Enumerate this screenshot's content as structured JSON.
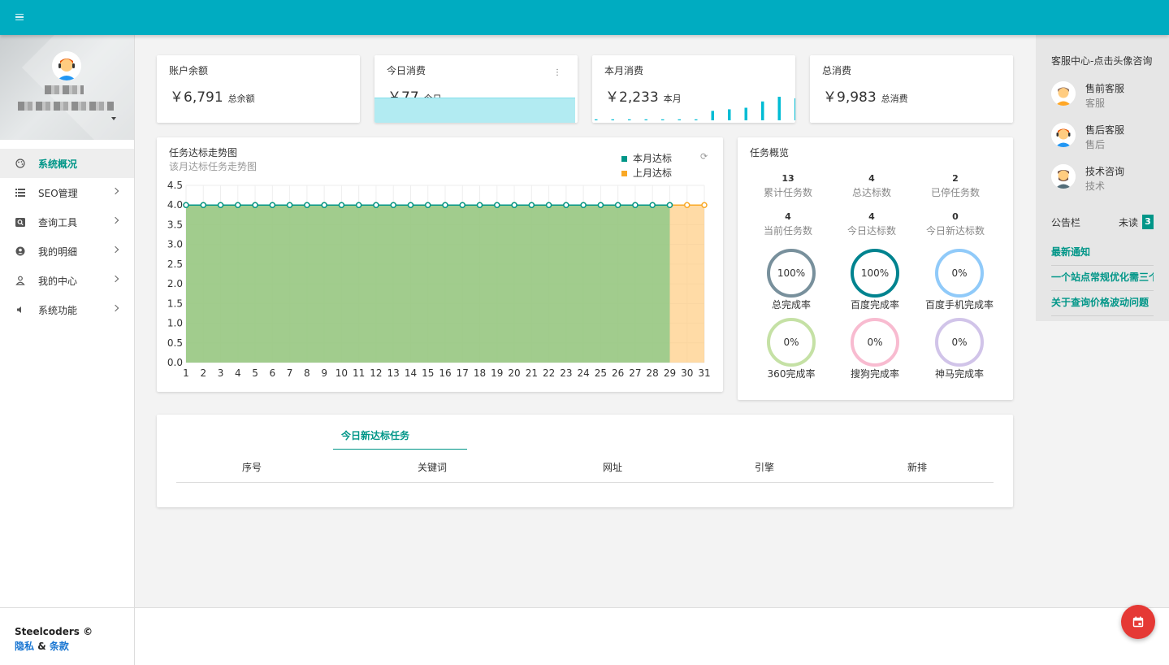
{
  "colors": {
    "topbar": "#00acc1",
    "accent": "#009688",
    "this_month": "#009688",
    "last_month": "#f9a825",
    "fab": "#e53935"
  },
  "topbar": {
    "menu_icon": "hamburger-icon"
  },
  "sidebar": {
    "items": [
      {
        "label": "系统概况",
        "icon": "palette-icon",
        "active": true
      },
      {
        "label": "SEO管理",
        "icon": "list-icon"
      },
      {
        "label": "查询工具",
        "icon": "search-box-icon"
      },
      {
        "label": "我的明细",
        "icon": "account-circle-icon"
      },
      {
        "label": "我的中心",
        "icon": "person-icon"
      },
      {
        "label": "系统功能",
        "icon": "volume-icon"
      }
    ],
    "footer": {
      "brand": "Steelcoders ©",
      "privacy": "隐私",
      "amp": "&",
      "terms": "条款"
    }
  },
  "stats": [
    {
      "title": "账户余额",
      "value": "￥6,791",
      "unit": "总余额"
    },
    {
      "title": "今日消费",
      "value": "￥77",
      "unit": "今日"
    },
    {
      "title": "本月消费",
      "value": "￥2,233",
      "unit": "本月"
    },
    {
      "title": "总消费",
      "value": "￥9,983",
      "unit": "总消费"
    }
  ],
  "month_sparkline": [
    0,
    0,
    0,
    0,
    0,
    0,
    0,
    3,
    3.5,
    4,
    6,
    7.5,
    7
  ],
  "trend": {
    "title": "任务达标走势图",
    "subtitle": "该月达标任务走势图",
    "refresh_icon": "refresh-icon"
  },
  "chart_data": {
    "type": "area",
    "x": [
      1,
      2,
      3,
      4,
      5,
      6,
      7,
      8,
      9,
      10,
      11,
      12,
      13,
      14,
      15,
      16,
      17,
      18,
      19,
      20,
      21,
      22,
      23,
      24,
      25,
      26,
      27,
      28,
      29,
      30,
      31
    ],
    "series": [
      {
        "name": "本月达标",
        "values": [
          4,
          4,
          4,
          4,
          4,
          4,
          4,
          4,
          4,
          4,
          4,
          4,
          4,
          4,
          4,
          4,
          4,
          4,
          4,
          4,
          4,
          4,
          4,
          4,
          4,
          4,
          4,
          4,
          4,
          null,
          null
        ]
      },
      {
        "name": "上月达标",
        "values": [
          4,
          4,
          4,
          4,
          4,
          4,
          4,
          4,
          4,
          4,
          4,
          4,
          4,
          4,
          4,
          4,
          4,
          4,
          4,
          4,
          4,
          4,
          4,
          4,
          4,
          4,
          4,
          4,
          4,
          4,
          4
        ]
      }
    ],
    "ylim": [
      0,
      4.5
    ],
    "yticks": [
      "0.0",
      "0.5",
      "1.0",
      "1.5",
      "2.0",
      "2.5",
      "3.0",
      "3.5",
      "4.0",
      "4.5"
    ],
    "legend": "top-right",
    "grid": true
  },
  "overview": {
    "title": "任务概览",
    "stats": [
      {
        "num": "13",
        "label": "累计任务数"
      },
      {
        "num": "4",
        "label": "总达标数"
      },
      {
        "num": "2",
        "label": "已停任务数"
      },
      {
        "num": "4",
        "label": "当前任务数"
      },
      {
        "num": "4",
        "label": "今日达标数"
      },
      {
        "num": "0",
        "label": "今日新达标数"
      }
    ],
    "gauges": [
      {
        "value": "100%",
        "label": "总完成率",
        "color": "#78909c"
      },
      {
        "value": "100%",
        "label": "百度完成率",
        "color": "#00838f"
      },
      {
        "value": "0%",
        "label": "百度手机完成率",
        "color": "#90caf9"
      },
      {
        "value": "0%",
        "label": "360完成率",
        "color": "#c5e1a5"
      },
      {
        "value": "0%",
        "label": "搜狗完成率",
        "color": "#f8bbd0"
      },
      {
        "value": "0%",
        "label": "神马完成率",
        "color": "#d1c4e9"
      }
    ]
  },
  "new_tasks": {
    "tab": "今日新达标任务",
    "columns": [
      "序号",
      "关键词",
      "网址",
      "引擎",
      "新排"
    ]
  },
  "right_panel": {
    "title": "客服中心-点击头像咨询",
    "agents": [
      {
        "name": "售前客服",
        "role": "客服"
      },
      {
        "name": "售后客服",
        "role": "售后"
      },
      {
        "name": "技术咨询",
        "role": "技术"
      }
    ],
    "notice_title": "公告栏",
    "unread_label": "未读",
    "unread_count": "3",
    "notices": [
      "最新通知",
      "一个站点常规优化需三个",
      "关于查询价格波动问题"
    ]
  },
  "fab": {
    "icon": "calendar-icon"
  }
}
